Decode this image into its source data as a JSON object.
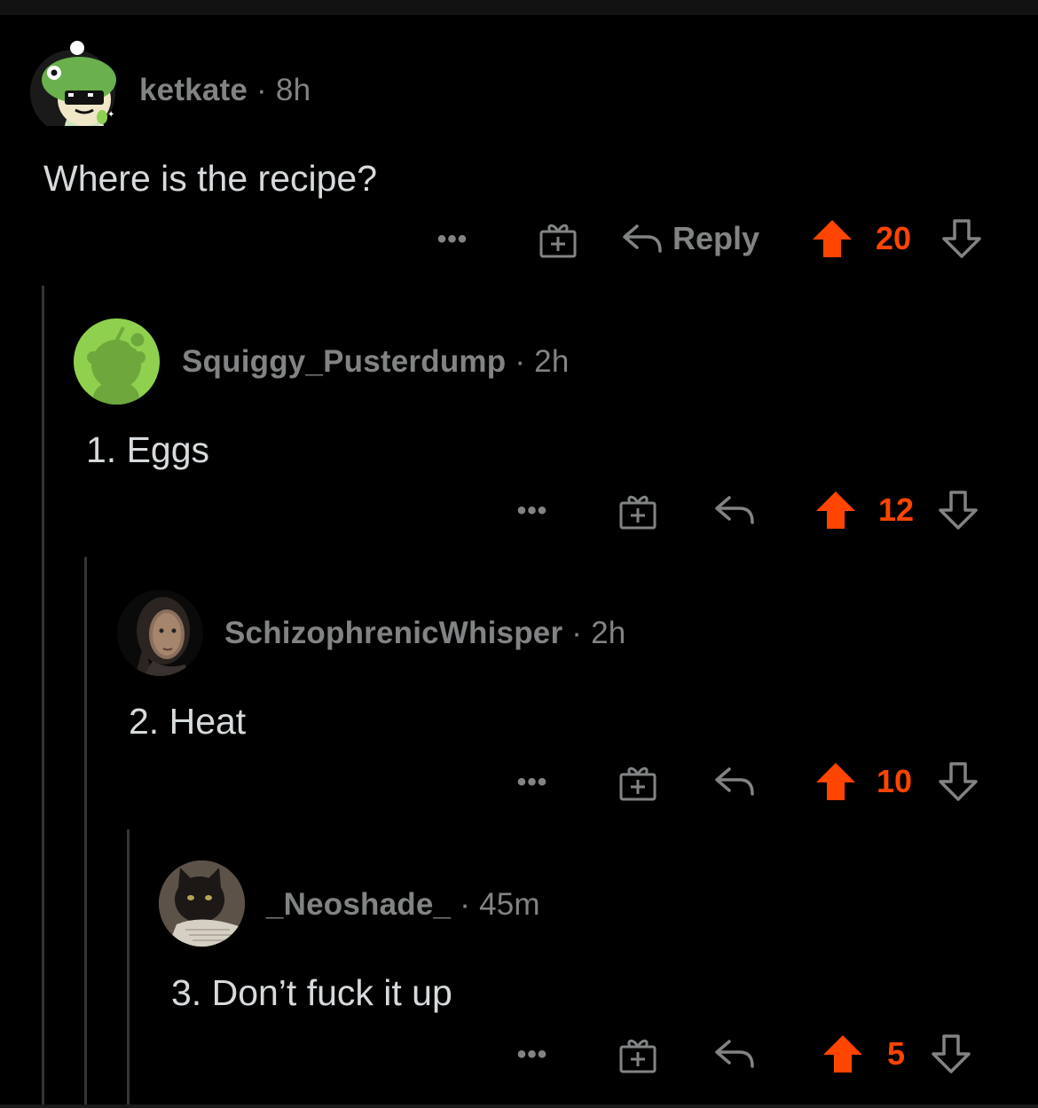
{
  "comments": [
    {
      "username": "ketkate",
      "separator": "·",
      "time": "8h",
      "body": "Where is the recipe?",
      "more_label": "•••",
      "reply_label": "Reply",
      "score": "20",
      "avatar": "snoo-frog-hat-avatar"
    },
    {
      "username": "Squiggy_Pusterdump",
      "separator": "·",
      "time": "2h",
      "body": "1. Eggs",
      "more_label": "•••",
      "score": "12",
      "avatar": "default-snoo-avatar"
    },
    {
      "username": "SchizophrenicWhisper",
      "separator": "·",
      "time": "2h",
      "body": "2. Heat",
      "more_label": "•••",
      "score": "10",
      "avatar": "girl-portrait-avatar"
    },
    {
      "username": "_Neoshade_",
      "separator": "·",
      "time": "45m",
      "body": "3. Don’t fuck it up",
      "more_label": "•••",
      "score": "5",
      "avatar": "black-cat-avatar"
    }
  ],
  "icons": {
    "more": "more-options-icon",
    "award": "gift-award-icon",
    "reply": "reply-arrow-icon",
    "upvote": "upvote-arrow-icon",
    "downvote": "downvote-arrow-icon"
  },
  "colors": {
    "background": "#000000",
    "upvote": "#ff4500",
    "meta_text": "#818384",
    "body_text": "#d7dadc",
    "thread_line": "#343536",
    "snoo_green": "#8fd14f"
  }
}
